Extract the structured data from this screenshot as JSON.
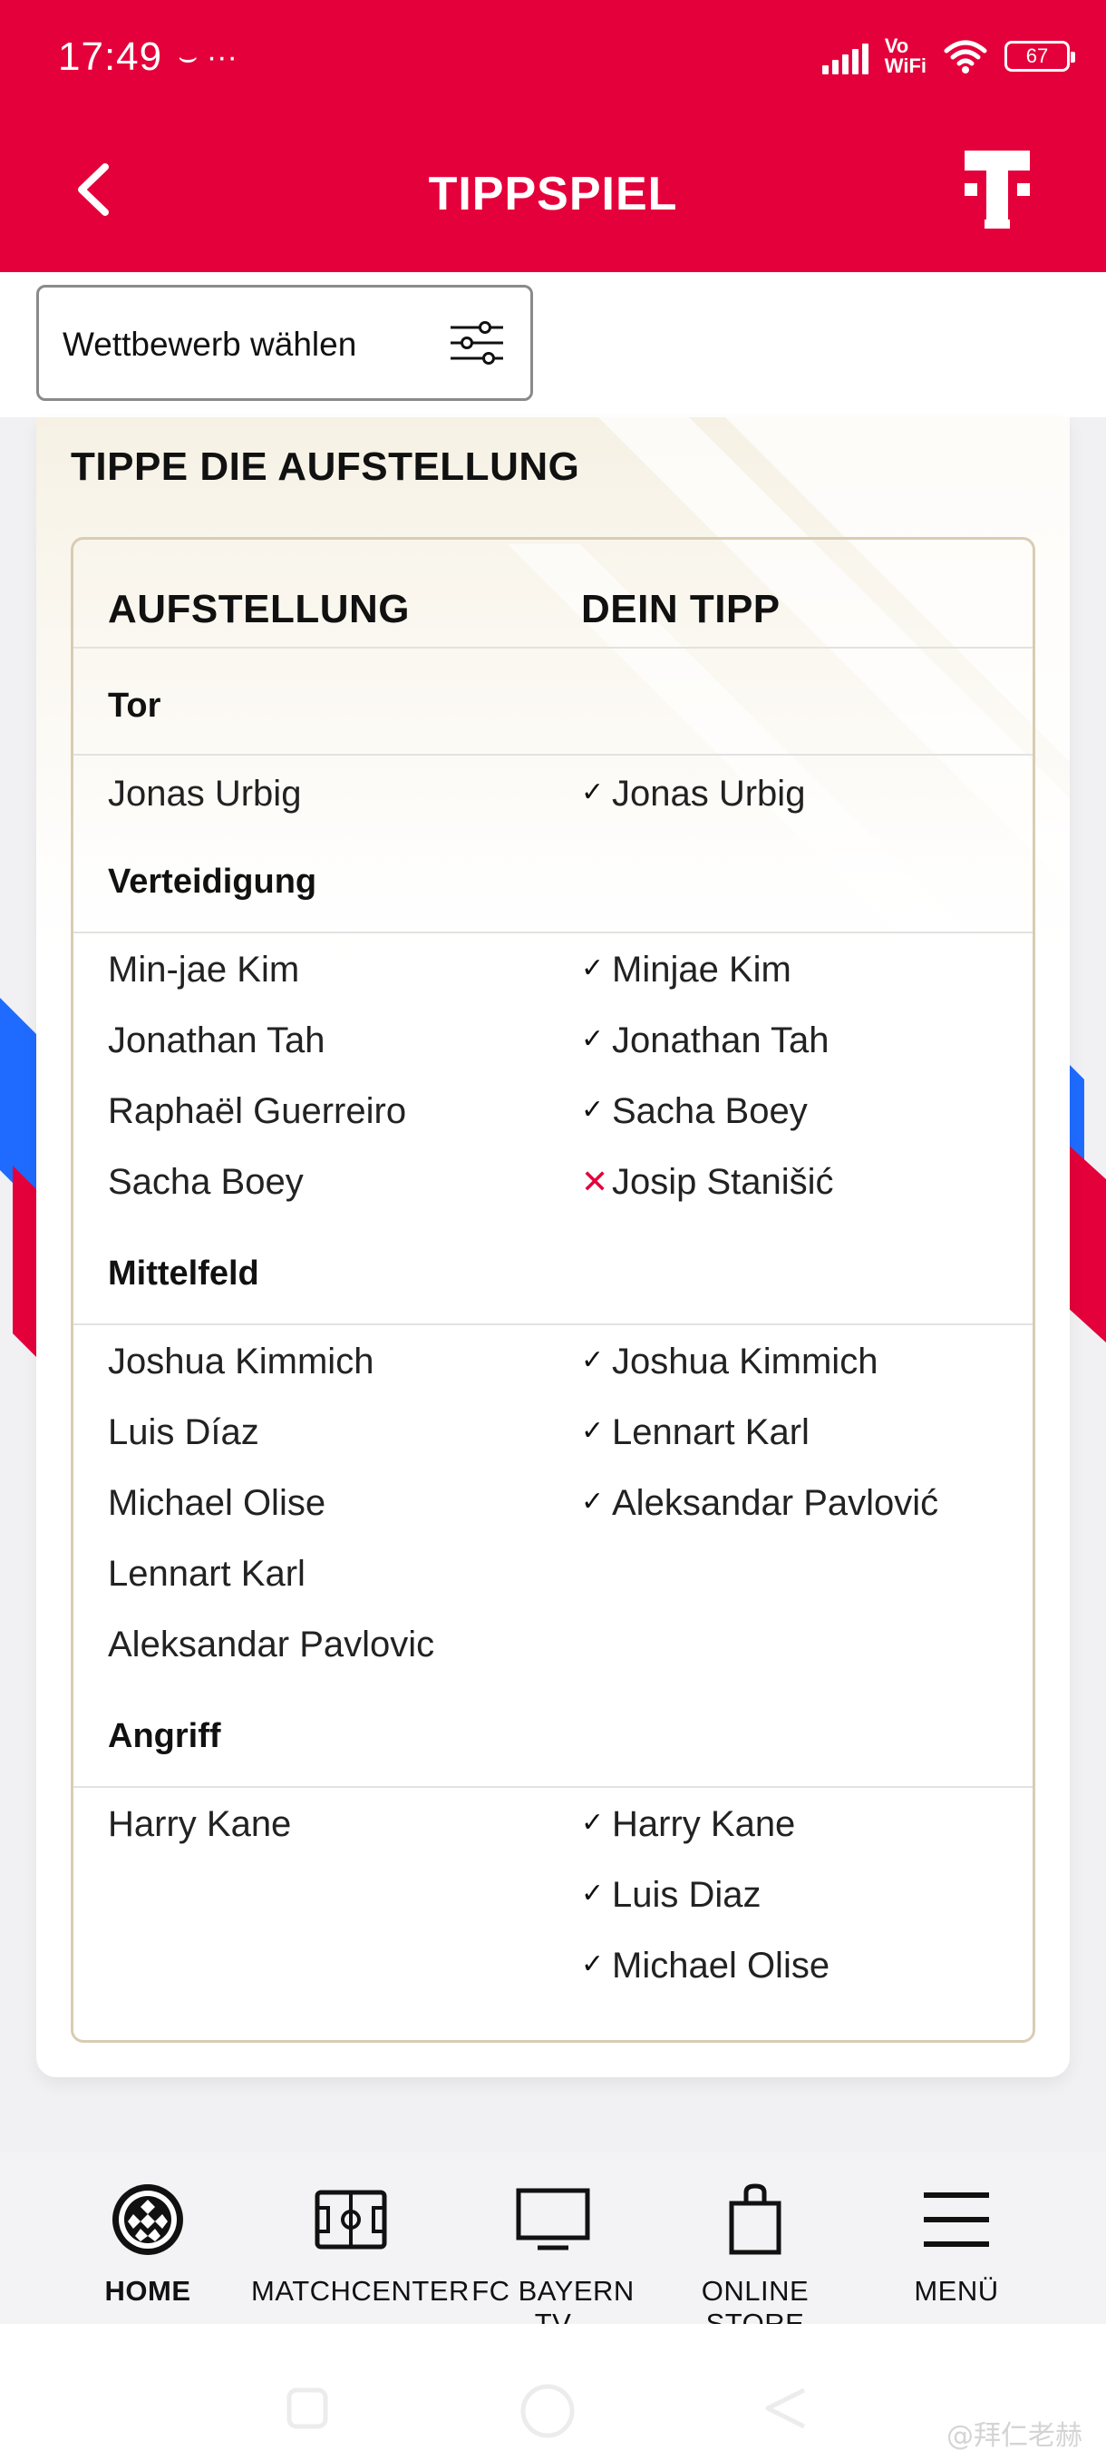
{
  "status_bar": {
    "time": "17:49",
    "extra_icons": "⌣ ···",
    "vowifi_line1": "Vo",
    "vowifi_line2": "WiFi",
    "battery": "67"
  },
  "header": {
    "title": "TIPPSPIEL",
    "brand_color": "#e4003a"
  },
  "filter": {
    "label": "Wettbewerb wählen"
  },
  "card": {
    "title": "TIPPE DIE AUFSTELLUNG",
    "col_lineup": "AUFSTELLUNG",
    "col_tip": "DEIN TIPP",
    "sections": [
      {
        "title": "Tor",
        "rows": [
          {
            "name": "Jonas Urbig",
            "tip": "Jonas Urbig",
            "result": "correct"
          }
        ]
      },
      {
        "title": "Verteidigung",
        "rows": [
          {
            "name": "Min-jae Kim",
            "tip": "Minjae Kim",
            "result": "correct"
          },
          {
            "name": "Jonathan Tah",
            "tip": "Jonathan Tah",
            "result": "correct"
          },
          {
            "name": "Raphaël Guerreiro",
            "tip": "Sacha Boey",
            "result": "correct"
          },
          {
            "name": "Sacha Boey",
            "tip": "Josip Stanišić",
            "result": "wrong"
          }
        ]
      },
      {
        "title": "Mittelfeld",
        "rows": [
          {
            "name": "Joshua Kimmich",
            "tip": "Joshua Kimmich",
            "result": "correct"
          },
          {
            "name": "Luis Díaz",
            "tip": "Lennart Karl",
            "result": "correct"
          },
          {
            "name": "Michael Olise",
            "tip": "Aleksandar Pavlović",
            "result": "correct"
          },
          {
            "name": "Lennart Karl",
            "tip": "",
            "result": ""
          },
          {
            "name": "Aleksandar Pavlovic",
            "tip": "",
            "result": ""
          }
        ]
      },
      {
        "title": "Angriff",
        "rows": [
          {
            "name": "Harry Kane",
            "tip": "Harry Kane",
            "result": "correct"
          },
          {
            "name": "",
            "tip": "Luis Diaz",
            "result": "correct"
          },
          {
            "name": "",
            "tip": "Michael Olise",
            "result": "correct"
          }
        ]
      }
    ],
    "mark_correct": "✓",
    "mark_wrong": "✕"
  },
  "bottom_nav": {
    "items": [
      {
        "label": "HOME",
        "icon": "fcb-crest-icon",
        "active": true
      },
      {
        "label": "MATCHCENTER",
        "icon": "pitch-icon",
        "active": false
      },
      {
        "label": "FC BAYERN TV",
        "icon": "tv-icon",
        "active": false
      },
      {
        "label": "ONLINE STORE",
        "icon": "shopping-bag-icon",
        "active": false
      },
      {
        "label": "MENÜ",
        "icon": "hamburger-menu-icon",
        "active": false
      }
    ]
  },
  "watermark": "@拜仁老赫"
}
